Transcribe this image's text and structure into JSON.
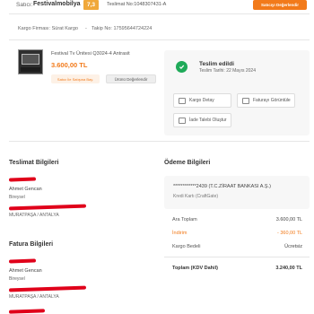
{
  "header": {
    "seller_prefix": "Satıcı:",
    "seller_name": "Festivalmobilya",
    "seller_rating": "7,3",
    "order_no": "Teslimat No:1048307431-A",
    "rate_seller_button": "Satıcıyı Değerlendir"
  },
  "cargo": {
    "firm": "Kargo Firması: Sürat Kargo",
    "tracking": "Takip No: 17595644724224"
  },
  "product": {
    "name": "Festival Tv Ünitesi Q3024-4 Antrasit",
    "price": "3.600,00 TL",
    "rate_seller_label": "Satıcı İle Satışına Bay.",
    "rate_product_label": "Ürünü Değerlendir"
  },
  "delivery": {
    "status": "Teslim edildi",
    "date": "Teslim Tarihi: 22 Mayıs 2024",
    "cargo_detail": "Kargo Detay",
    "invoice": "Faturayı Görüntüle",
    "return_request": "İade Talebi Oluştur"
  },
  "shipping_address": {
    "title": "Teslimat Bilgileri",
    "name": "Ahmet Gencan",
    "type": "Bireysel",
    "city": "MURATPAŞA / ANTALYA"
  },
  "billing_address": {
    "title": "Fatura Bilgileri",
    "name": "Ahmet Gencan",
    "type": "Bireysel",
    "city": "MURATPAŞA / ANTALYA"
  },
  "payment": {
    "title": "Ödeme Bilgileri",
    "card_number": "************2439 (T.C.ZİRAAT BANKASI A.Ş.)",
    "card_type": "Kredi Kartı (CraftGate)",
    "rows": [
      {
        "label": "Ara Toplam",
        "value": "3.600,00 TL"
      },
      {
        "label": "İndirim",
        "value": "- 360,00 TL"
      },
      {
        "label": "Kargo Bedeli",
        "value": "Ücretsiz"
      }
    ],
    "total_label": "Toplam (KDV Dahil)",
    "total_value": "3.240,00 TL"
  },
  "colors": {
    "accent": "#f27a1a",
    "success": "#1faa59",
    "redaction": "#e0001a"
  }
}
